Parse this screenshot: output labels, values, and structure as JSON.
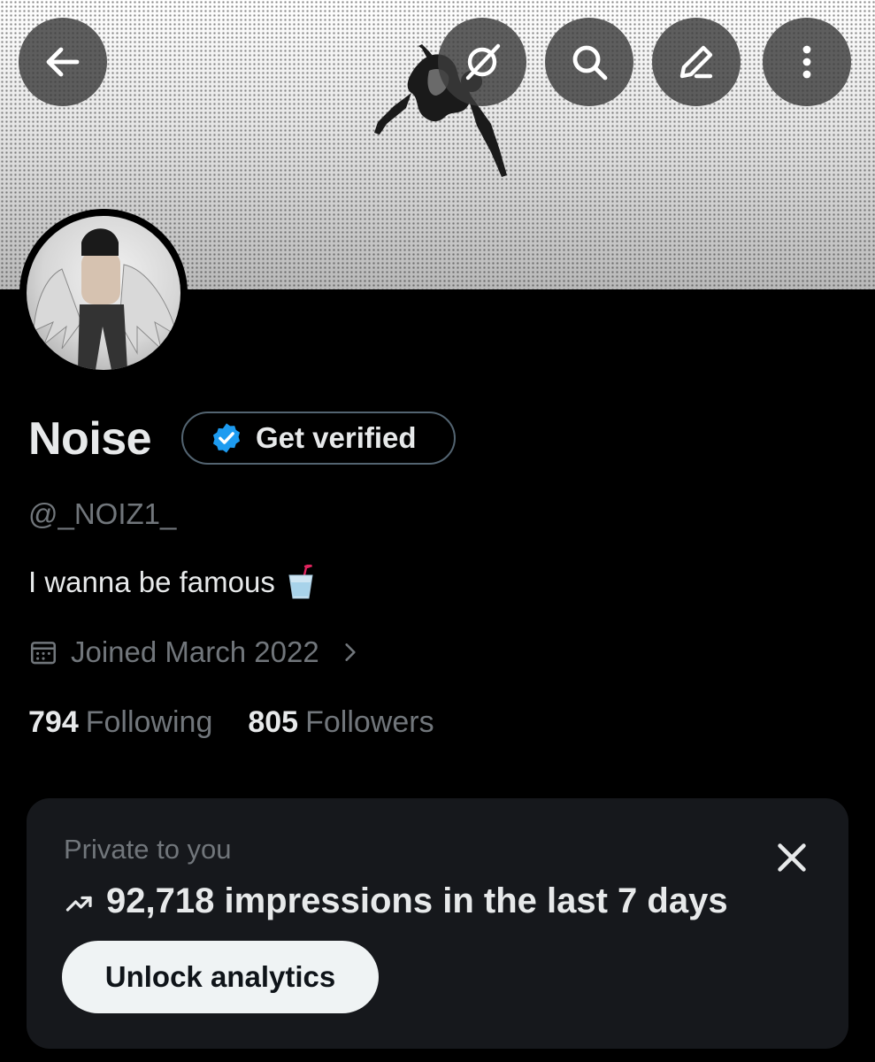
{
  "profile": {
    "name": "Noise",
    "handle": "@_NOIZ1_",
    "bio": "I wanna be famous",
    "bio_emoji": "cup-with-straw-emoji",
    "joined": "Joined March 2022",
    "following_count": "794",
    "following_label": "Following",
    "followers_count": "805",
    "followers_label": "Followers"
  },
  "header": {
    "buttons": [
      "back-arrow-icon",
      "grok-icon",
      "search-icon",
      "edit-icon",
      "more-vertical-icon"
    ]
  },
  "verify": {
    "label": "Get verified",
    "badge_color": "#1d9bf0"
  },
  "analytics_card": {
    "private_label": "Private to you",
    "impressions_text": "92,718 impressions in the last 7 days",
    "unlock_label": "Unlock analytics"
  },
  "colors": {
    "background": "#000000",
    "primary_text": "#e7e9ea",
    "secondary_text": "#71767b",
    "card_bg": "#16181c"
  }
}
